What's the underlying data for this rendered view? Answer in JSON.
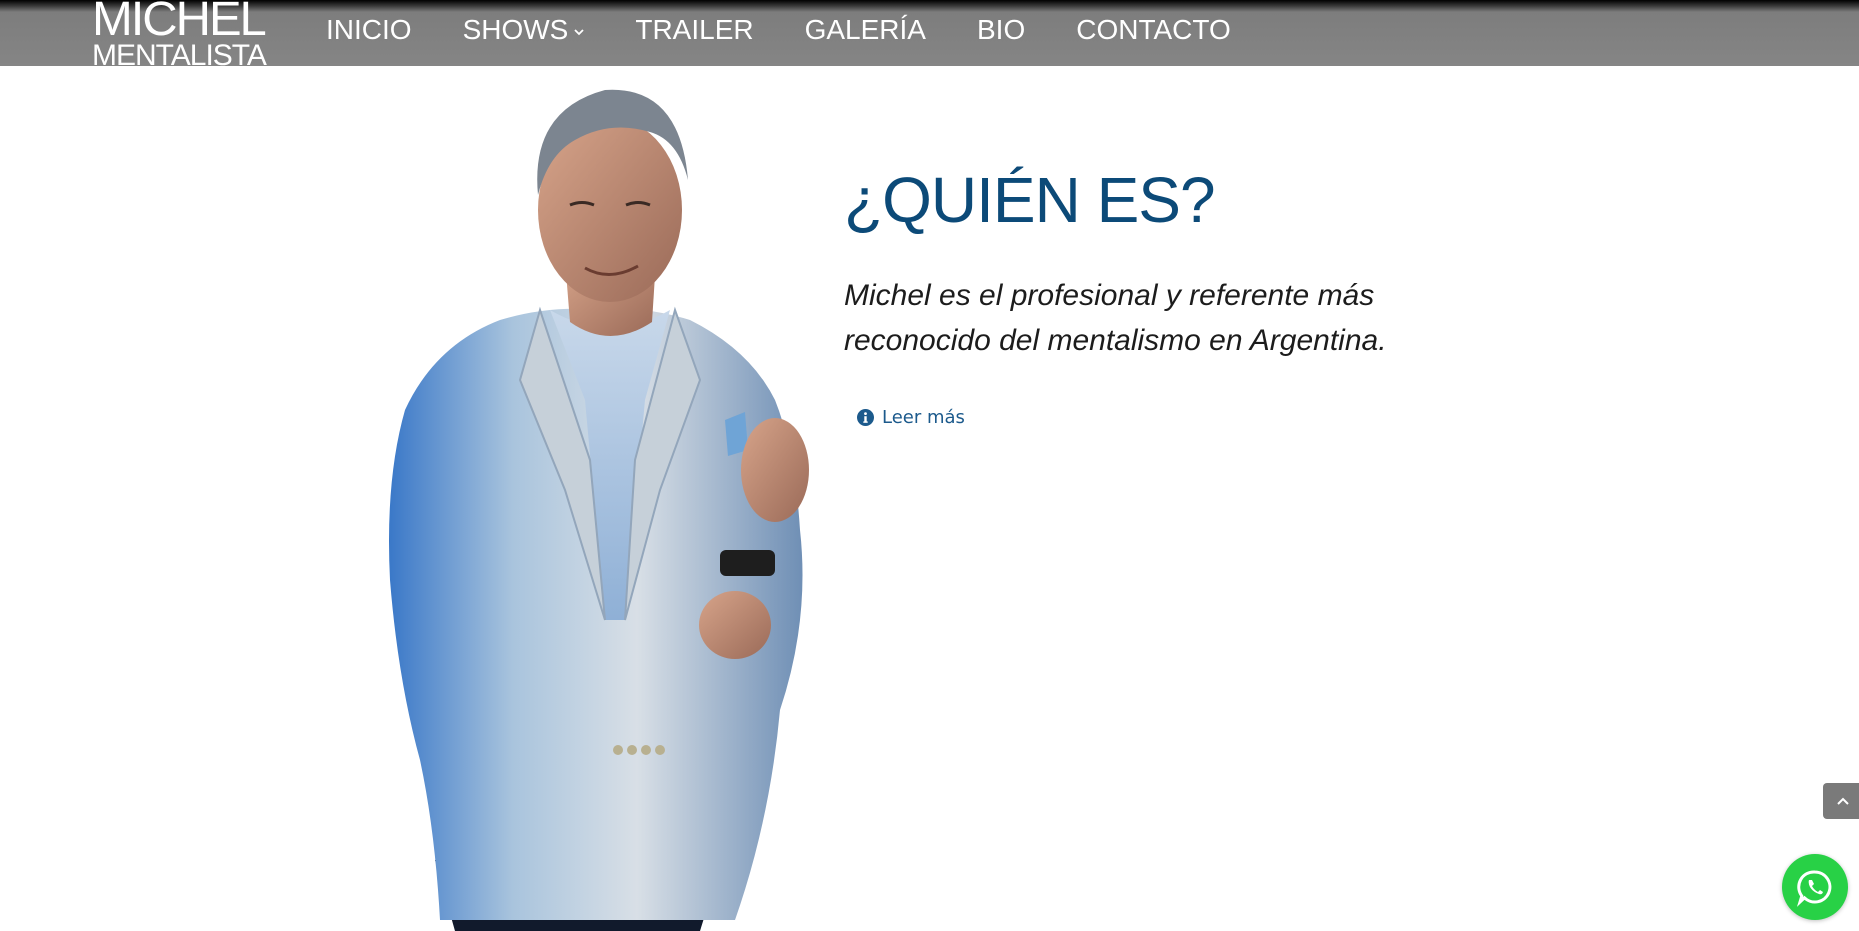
{
  "header": {
    "logo": {
      "line1": "MICHEL",
      "line2": "MENTALISTA"
    },
    "nav": [
      {
        "label": "INICIO"
      },
      {
        "label": "SHOWS",
        "icon": "chevron-down-icon"
      },
      {
        "label": "TRAILER"
      },
      {
        "label": "GALERÍA"
      },
      {
        "label": "BIO"
      },
      {
        "label": "CONTACTO"
      }
    ]
  },
  "main": {
    "title": "¿QUIÉN ES?",
    "intro": "Michel es el profesional y referente más reconocido del mentalismo en Argentina.",
    "read_more": {
      "label": "Leer más",
      "icon": "info-circle-icon"
    },
    "photo": {
      "alt": "Michel"
    }
  },
  "floating": {
    "scroll_top_icon": "chevron-up-icon",
    "whatsapp_icon": "whatsapp-icon"
  },
  "colors": {
    "header_bg": "#858585",
    "title": "#0c4a78",
    "link": "#1c5a8c",
    "whatsapp": "#28d146"
  }
}
